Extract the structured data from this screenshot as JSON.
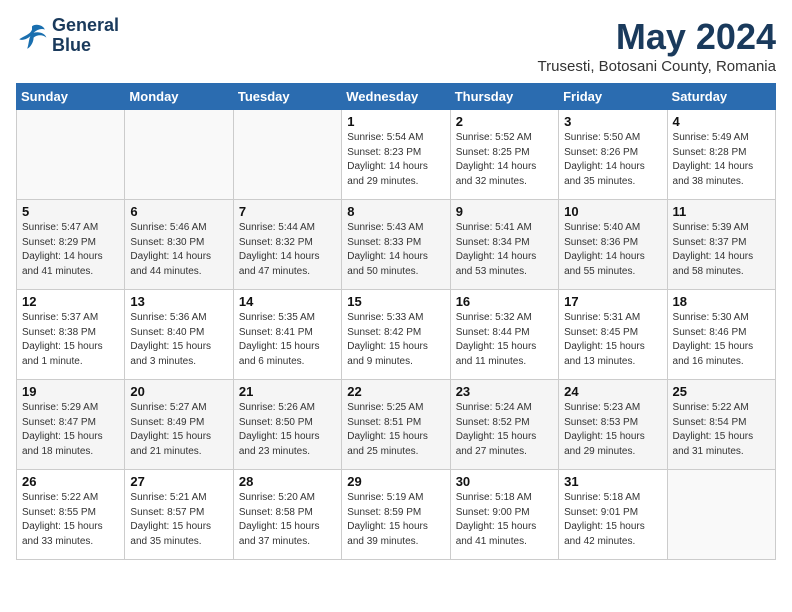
{
  "header": {
    "logo_line1": "General",
    "logo_line2": "Blue",
    "month": "May 2024",
    "location": "Trusesti, Botosani County, Romania"
  },
  "weekdays": [
    "Sunday",
    "Monday",
    "Tuesday",
    "Wednesday",
    "Thursday",
    "Friday",
    "Saturday"
  ],
  "weeks": [
    [
      {
        "day": "",
        "info": ""
      },
      {
        "day": "",
        "info": ""
      },
      {
        "day": "",
        "info": ""
      },
      {
        "day": "1",
        "info": "Sunrise: 5:54 AM\nSunset: 8:23 PM\nDaylight: 14 hours\nand 29 minutes."
      },
      {
        "day": "2",
        "info": "Sunrise: 5:52 AM\nSunset: 8:25 PM\nDaylight: 14 hours\nand 32 minutes."
      },
      {
        "day": "3",
        "info": "Sunrise: 5:50 AM\nSunset: 8:26 PM\nDaylight: 14 hours\nand 35 minutes."
      },
      {
        "day": "4",
        "info": "Sunrise: 5:49 AM\nSunset: 8:28 PM\nDaylight: 14 hours\nand 38 minutes."
      }
    ],
    [
      {
        "day": "5",
        "info": "Sunrise: 5:47 AM\nSunset: 8:29 PM\nDaylight: 14 hours\nand 41 minutes."
      },
      {
        "day": "6",
        "info": "Sunrise: 5:46 AM\nSunset: 8:30 PM\nDaylight: 14 hours\nand 44 minutes."
      },
      {
        "day": "7",
        "info": "Sunrise: 5:44 AM\nSunset: 8:32 PM\nDaylight: 14 hours\nand 47 minutes."
      },
      {
        "day": "8",
        "info": "Sunrise: 5:43 AM\nSunset: 8:33 PM\nDaylight: 14 hours\nand 50 minutes."
      },
      {
        "day": "9",
        "info": "Sunrise: 5:41 AM\nSunset: 8:34 PM\nDaylight: 14 hours\nand 53 minutes."
      },
      {
        "day": "10",
        "info": "Sunrise: 5:40 AM\nSunset: 8:36 PM\nDaylight: 14 hours\nand 55 minutes."
      },
      {
        "day": "11",
        "info": "Sunrise: 5:39 AM\nSunset: 8:37 PM\nDaylight: 14 hours\nand 58 minutes."
      }
    ],
    [
      {
        "day": "12",
        "info": "Sunrise: 5:37 AM\nSunset: 8:38 PM\nDaylight: 15 hours\nand 1 minute."
      },
      {
        "day": "13",
        "info": "Sunrise: 5:36 AM\nSunset: 8:40 PM\nDaylight: 15 hours\nand 3 minutes."
      },
      {
        "day": "14",
        "info": "Sunrise: 5:35 AM\nSunset: 8:41 PM\nDaylight: 15 hours\nand 6 minutes."
      },
      {
        "day": "15",
        "info": "Sunrise: 5:33 AM\nSunset: 8:42 PM\nDaylight: 15 hours\nand 9 minutes."
      },
      {
        "day": "16",
        "info": "Sunrise: 5:32 AM\nSunset: 8:44 PM\nDaylight: 15 hours\nand 11 minutes."
      },
      {
        "day": "17",
        "info": "Sunrise: 5:31 AM\nSunset: 8:45 PM\nDaylight: 15 hours\nand 13 minutes."
      },
      {
        "day": "18",
        "info": "Sunrise: 5:30 AM\nSunset: 8:46 PM\nDaylight: 15 hours\nand 16 minutes."
      }
    ],
    [
      {
        "day": "19",
        "info": "Sunrise: 5:29 AM\nSunset: 8:47 PM\nDaylight: 15 hours\nand 18 minutes."
      },
      {
        "day": "20",
        "info": "Sunrise: 5:27 AM\nSunset: 8:49 PM\nDaylight: 15 hours\nand 21 minutes."
      },
      {
        "day": "21",
        "info": "Sunrise: 5:26 AM\nSunset: 8:50 PM\nDaylight: 15 hours\nand 23 minutes."
      },
      {
        "day": "22",
        "info": "Sunrise: 5:25 AM\nSunset: 8:51 PM\nDaylight: 15 hours\nand 25 minutes."
      },
      {
        "day": "23",
        "info": "Sunrise: 5:24 AM\nSunset: 8:52 PM\nDaylight: 15 hours\nand 27 minutes."
      },
      {
        "day": "24",
        "info": "Sunrise: 5:23 AM\nSunset: 8:53 PM\nDaylight: 15 hours\nand 29 minutes."
      },
      {
        "day": "25",
        "info": "Sunrise: 5:22 AM\nSunset: 8:54 PM\nDaylight: 15 hours\nand 31 minutes."
      }
    ],
    [
      {
        "day": "26",
        "info": "Sunrise: 5:22 AM\nSunset: 8:55 PM\nDaylight: 15 hours\nand 33 minutes."
      },
      {
        "day": "27",
        "info": "Sunrise: 5:21 AM\nSunset: 8:57 PM\nDaylight: 15 hours\nand 35 minutes."
      },
      {
        "day": "28",
        "info": "Sunrise: 5:20 AM\nSunset: 8:58 PM\nDaylight: 15 hours\nand 37 minutes."
      },
      {
        "day": "29",
        "info": "Sunrise: 5:19 AM\nSunset: 8:59 PM\nDaylight: 15 hours\nand 39 minutes."
      },
      {
        "day": "30",
        "info": "Sunrise: 5:18 AM\nSunset: 9:00 PM\nDaylight: 15 hours\nand 41 minutes."
      },
      {
        "day": "31",
        "info": "Sunrise: 5:18 AM\nSunset: 9:01 PM\nDaylight: 15 hours\nand 42 minutes."
      },
      {
        "day": "",
        "info": ""
      }
    ]
  ]
}
